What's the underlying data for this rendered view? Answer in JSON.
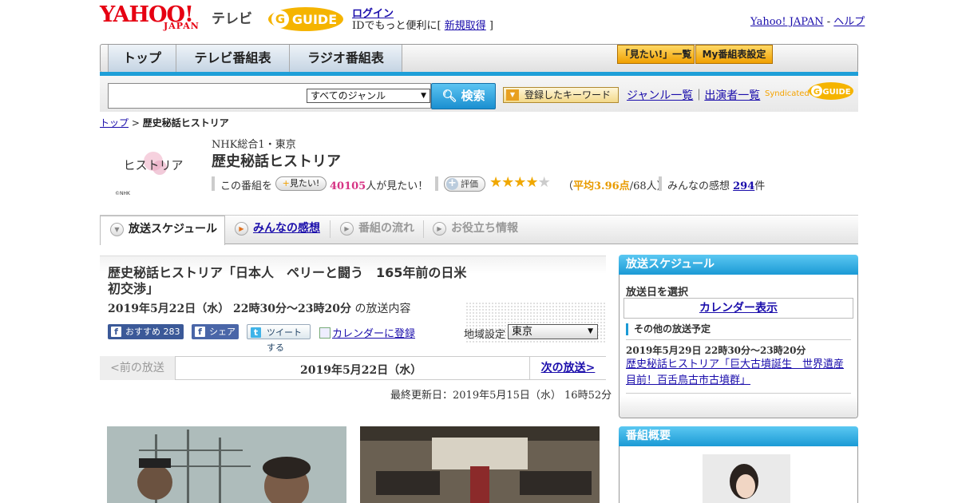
{
  "header": {
    "logo_yahoo": "YAHOO!",
    "logo_japan": "JAPAN",
    "logo_tv": "テレビ",
    "logo_gguide": "GUIDE",
    "login": "ログイン",
    "id_text_prefix": "IDでもっと便利に[ ",
    "signup": "新規取得",
    "id_text_suffix": " ]",
    "yahoo_japan": "Yahoo! JAPAN",
    "separator": " - ",
    "help": "ヘルプ"
  },
  "nav": {
    "tabs": [
      "トップ",
      "テレビ番組表",
      "ラジオ番組表"
    ],
    "want_list": "「見たい!」一覧",
    "my_schedule": "My番組表設定"
  },
  "search": {
    "genre_selected": "すべてのジャンル",
    "button": "検索",
    "keyword_button": "登録したキーワード",
    "genre_list": "ジャンル一覧",
    "link_sep": "｜",
    "cast_list": "出演者一覧",
    "syndicated": "Syndicated",
    "gguide_small": "GUIDE"
  },
  "breadcrumb": {
    "top": "トップ",
    "sep": " > ",
    "current": "歴史秘話ヒストリア"
  },
  "program": {
    "logo_text": "ヒストリア",
    "logo_credit": "©NHK",
    "channel": "NHK総合1・東京",
    "title": "歴史秘話ヒストリア",
    "watch_prefix": "この番組を",
    "watch_button": "見たい!",
    "watch_count": "40105",
    "watch_suffix": "人が見たい！",
    "rate_button": "評価",
    "rating_value": 3.96,
    "avg_prefix": "（",
    "avg_label": "平均3.96点",
    "avg_suffix": "/68人）",
    "impressions_prefix": "みんなの感想 ",
    "impressions_count": "294",
    "impressions_suffix": "件"
  },
  "tabs": {
    "schedule": "放送スケジュール",
    "impressions": "みんなの感想",
    "flow": "番組の流れ",
    "info": "お役立ち情報"
  },
  "episode": {
    "title": "歴史秘話ヒストリア「日本人　ペリーと闘う　165年前の日米初交渉」",
    "date": "2019年5月22日（水）  22時30分～23時20分",
    "date_suffix": " の放送内容",
    "fb_recommend": "おすすめ",
    "fb_count": "283",
    "fb_share": "シェア",
    "tweet": "ツイートする",
    "calendar_register": "カレンダーに登録",
    "region_label": "地域設定",
    "region_selected": "東京",
    "prev": "<前の放送",
    "current_date": "2019年5月22日（水）",
    "next": "次の放送>",
    "updated": "最終更新日：2019年5月15日（水）  16時52分"
  },
  "sidebar": {
    "schedule_head": "放送スケジュール",
    "select_day": "放送日を選択",
    "calendar_show": "カレンダー表示",
    "other_label": "その他の放送予定",
    "other_date": "2019年5月29日  22時30分～23時20分",
    "other_title": "歴史秘話ヒストリア「巨大古墳誕生　世界遺産目前！百舌鳥古市古墳群」",
    "overview_head": "番組概要"
  },
  "colors": {
    "accent_blue": "#1b9ad5",
    "yahoo_red": "#e60012",
    "star": "#f0a800"
  }
}
